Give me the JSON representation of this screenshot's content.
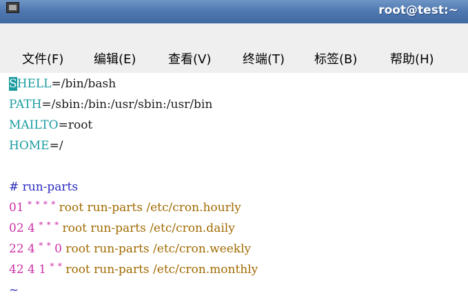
{
  "window": {
    "title": "root@test:~",
    "icon": "terminal-window-icon"
  },
  "menubar": {
    "items": [
      {
        "label": "文件(F)"
      },
      {
        "label": "编辑(E)"
      },
      {
        "label": "查看(V)"
      },
      {
        "label": "终端(T)"
      },
      {
        "label": "标签(B)"
      },
      {
        "label": "帮助(H)"
      }
    ]
  },
  "terminal": {
    "env": [
      {
        "cursor_char": "S",
        "name": "HELL",
        "eq": "=",
        "value": "/bin/bash"
      },
      {
        "name": "PATH",
        "eq": "=",
        "value": "/sbin:/bin:/usr/sbin:/usr/bin"
      },
      {
        "name": "MAILTO",
        "eq": "=",
        "value": "root"
      },
      {
        "name": "HOME",
        "eq": "=",
        "value": "/"
      }
    ],
    "comment": "# run-parts",
    "cron": [
      {
        "minute": "01",
        "hour": "*",
        "day": "*",
        "month": "*",
        "weekday": "*",
        "command": "root run-parts /etc/cron.hourly"
      },
      {
        "minute": "02",
        "hour": "4",
        "day": "*",
        "month": "*",
        "weekday": "*",
        "command": "root run-parts /etc/cron.daily"
      },
      {
        "minute": "22",
        "hour": "4",
        "day": "*",
        "month": "*",
        "weekday": "0",
        "command": "root run-parts /etc/cron.weekly"
      },
      {
        "minute": "42",
        "hour": "4",
        "day": "1",
        "month": "*",
        "weekday": "*",
        "command": "root run-parts /etc/cron.monthly"
      }
    ],
    "tilde": "~"
  },
  "colors": {
    "titlebar": "#4f78b0",
    "cursor": "#1b9ca0",
    "variable": "#1b9ca0",
    "comment": "#2a2ac0",
    "number": "#cc2fa6",
    "command": "#a06a00"
  }
}
